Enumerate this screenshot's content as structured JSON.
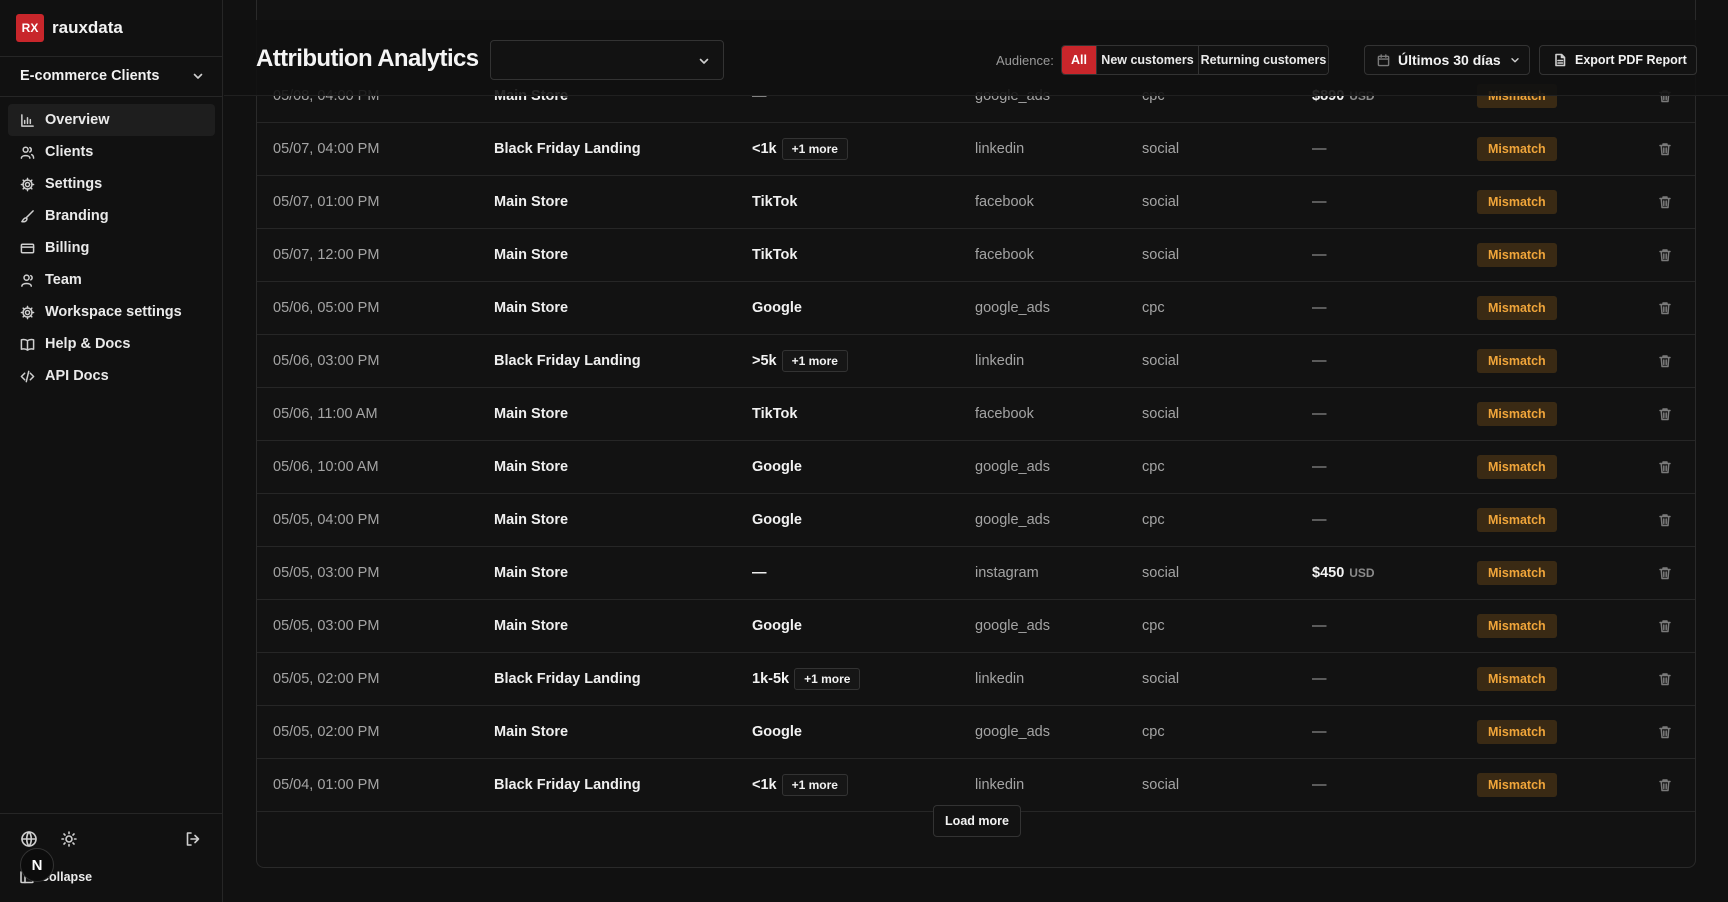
{
  "brand": {
    "logo_text": "RX",
    "name": "rauxdata",
    "logo_color": "#c8262b"
  },
  "sidebar": {
    "client_selector": "E-commerce Clients",
    "items": [
      {
        "label": "Overview",
        "icon": "chart-bar-icon",
        "active": true
      },
      {
        "label": "Clients",
        "icon": "users-icon"
      },
      {
        "label": "Settings",
        "icon": "gear-icon"
      },
      {
        "label": "Branding",
        "icon": "brush-icon"
      },
      {
        "label": "Billing",
        "icon": "credit-card-icon"
      },
      {
        "label": "Team",
        "icon": "user-icon"
      },
      {
        "label": "Workspace settings",
        "icon": "gear-icon"
      },
      {
        "label": "Help & Docs",
        "icon": "book-icon"
      },
      {
        "label": "API Docs",
        "icon": "code-icon"
      }
    ],
    "avatar_initial": "N",
    "collapse_label": "Collapse"
  },
  "header": {
    "title": "Attribution Analytics",
    "audience_label": "Audience:",
    "audience_options": [
      "All",
      "New customers",
      "Returning customers"
    ],
    "audience_selected": "All",
    "date_range": "Últimos 30 días",
    "export_label": "Export PDF Report"
  },
  "table": {
    "rows": [
      {
        "date": "05/08, 04:00 PM",
        "site": "Main Store",
        "source": "—",
        "more": "",
        "utm": "google_ads",
        "medium": "cpc",
        "revenue": "$890",
        "currency": "USD",
        "status": "Mismatch"
      },
      {
        "date": "05/07, 04:00 PM",
        "site": "Black Friday Landing",
        "source": "<1k",
        "more": "+1 more",
        "utm": "linkedin",
        "medium": "social",
        "revenue": "—",
        "currency": "",
        "status": "Mismatch"
      },
      {
        "date": "05/07, 01:00 PM",
        "site": "Main Store",
        "source": "TikTok",
        "more": "",
        "utm": "facebook",
        "medium": "social",
        "revenue": "—",
        "currency": "",
        "status": "Mismatch"
      },
      {
        "date": "05/07, 12:00 PM",
        "site": "Main Store",
        "source": "TikTok",
        "more": "",
        "utm": "facebook",
        "medium": "social",
        "revenue": "—",
        "currency": "",
        "status": "Mismatch"
      },
      {
        "date": "05/06, 05:00 PM",
        "site": "Main Store",
        "source": "Google",
        "more": "",
        "utm": "google_ads",
        "medium": "cpc",
        "revenue": "—",
        "currency": "",
        "status": "Mismatch"
      },
      {
        "date": "05/06, 03:00 PM",
        "site": "Black Friday Landing",
        "source": ">5k",
        "more": "+1 more",
        "utm": "linkedin",
        "medium": "social",
        "revenue": "—",
        "currency": "",
        "status": "Mismatch"
      },
      {
        "date": "05/06, 11:00 AM",
        "site": "Main Store",
        "source": "TikTok",
        "more": "",
        "utm": "facebook",
        "medium": "social",
        "revenue": "—",
        "currency": "",
        "status": "Mismatch"
      },
      {
        "date": "05/06, 10:00 AM",
        "site": "Main Store",
        "source": "Google",
        "more": "",
        "utm": "google_ads",
        "medium": "cpc",
        "revenue": "—",
        "currency": "",
        "status": "Mismatch"
      },
      {
        "date": "05/05, 04:00 PM",
        "site": "Main Store",
        "source": "Google",
        "more": "",
        "utm": "google_ads",
        "medium": "cpc",
        "revenue": "—",
        "currency": "",
        "status": "Mismatch"
      },
      {
        "date": "05/05, 03:00 PM",
        "site": "Main Store",
        "source": "—",
        "more": "",
        "utm": "instagram",
        "medium": "social",
        "revenue": "$450",
        "currency": "USD",
        "status": "Mismatch"
      },
      {
        "date": "05/05, 03:00 PM",
        "site": "Main Store",
        "source": "Google",
        "more": "",
        "utm": "google_ads",
        "medium": "cpc",
        "revenue": "—",
        "currency": "",
        "status": "Mismatch"
      },
      {
        "date": "05/05, 02:00 PM",
        "site": "Black Friday Landing",
        "source": "1k-5k",
        "more": "+1 more",
        "utm": "linkedin",
        "medium": "social",
        "revenue": "—",
        "currency": "",
        "status": "Mismatch"
      },
      {
        "date": "05/05, 02:00 PM",
        "site": "Main Store",
        "source": "Google",
        "more": "",
        "utm": "google_ads",
        "medium": "cpc",
        "revenue": "—",
        "currency": "",
        "status": "Mismatch"
      },
      {
        "date": "05/04, 01:00 PM",
        "site": "Black Friday Landing",
        "source": "<1k",
        "more": "+1 more",
        "utm": "linkedin",
        "medium": "social",
        "revenue": "—",
        "currency": "",
        "status": "Mismatch"
      }
    ],
    "load_more_label": "Load more"
  },
  "colors": {
    "accent": "#c8262b",
    "status_text": "#f0a53a",
    "status_bg": "#3a2a14",
    "background": "#111111"
  }
}
